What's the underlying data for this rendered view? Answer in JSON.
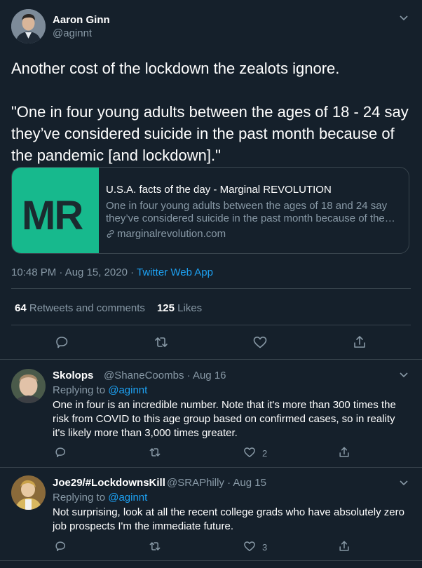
{
  "tweet": {
    "author_name": "Aaron Ginn",
    "author_handle": "@aginnt",
    "text": "Another cost of the lockdown the zealots ignore.\n\n\"One in four young adults between the ages of 18 - 24 say they’ve considered suicide in the past month because of the pandemic [and lockdown].\"",
    "card": {
      "logo_text": "MR",
      "title": "U.S.A. facts of the day - Marginal REVOLUTION",
      "description_line1": "One in four young adults between the ages of 18 and 24 say",
      "description_line2": "they’ve considered suicide in the past month because of the ...",
      "domain": "marginalrevolution.com"
    },
    "timestamp": "10:48 PM · Aug 15, 2020 · ",
    "source_app": "Twitter Web App",
    "retweets_count": "64",
    "retweets_label": "Retweets and comments",
    "likes_count": "125",
    "likes_label": "Likes"
  },
  "replies": [
    {
      "name": "Skolops",
      "handle_date": "@ShaneCoombs · Aug 16",
      "replying_prefix": "Replying to ",
      "replying_to": "@aginnt",
      "text": "One in four is an incredible number. Note that it's more than 300 times the risk from COVID to this age group based on confirmed cases, so in reality it's likely more than 3,000 times greater.",
      "likes": "2"
    },
    {
      "name": "Joe29/#LockdownsKill",
      "handle_date": "@SRAPhilly · Aug 15",
      "replying_prefix": "Replying to ",
      "replying_to": "@aginnt",
      "text": "Not surprising, look at all the recent college grads who have absolutely zero job prospects I'm the immediate future.",
      "likes": "3"
    }
  ],
  "icons": {
    "reply": "reply-icon",
    "retweet": "retweet-icon",
    "like": "heart-icon",
    "share": "share-icon",
    "more": "chevron-down-icon",
    "link": "link-icon"
  },
  "colors": {
    "background": "#15202b",
    "border": "#38444d",
    "secondary_text": "#8899a6",
    "accent": "#1da1f2",
    "card_thumb": "#17b98d"
  }
}
